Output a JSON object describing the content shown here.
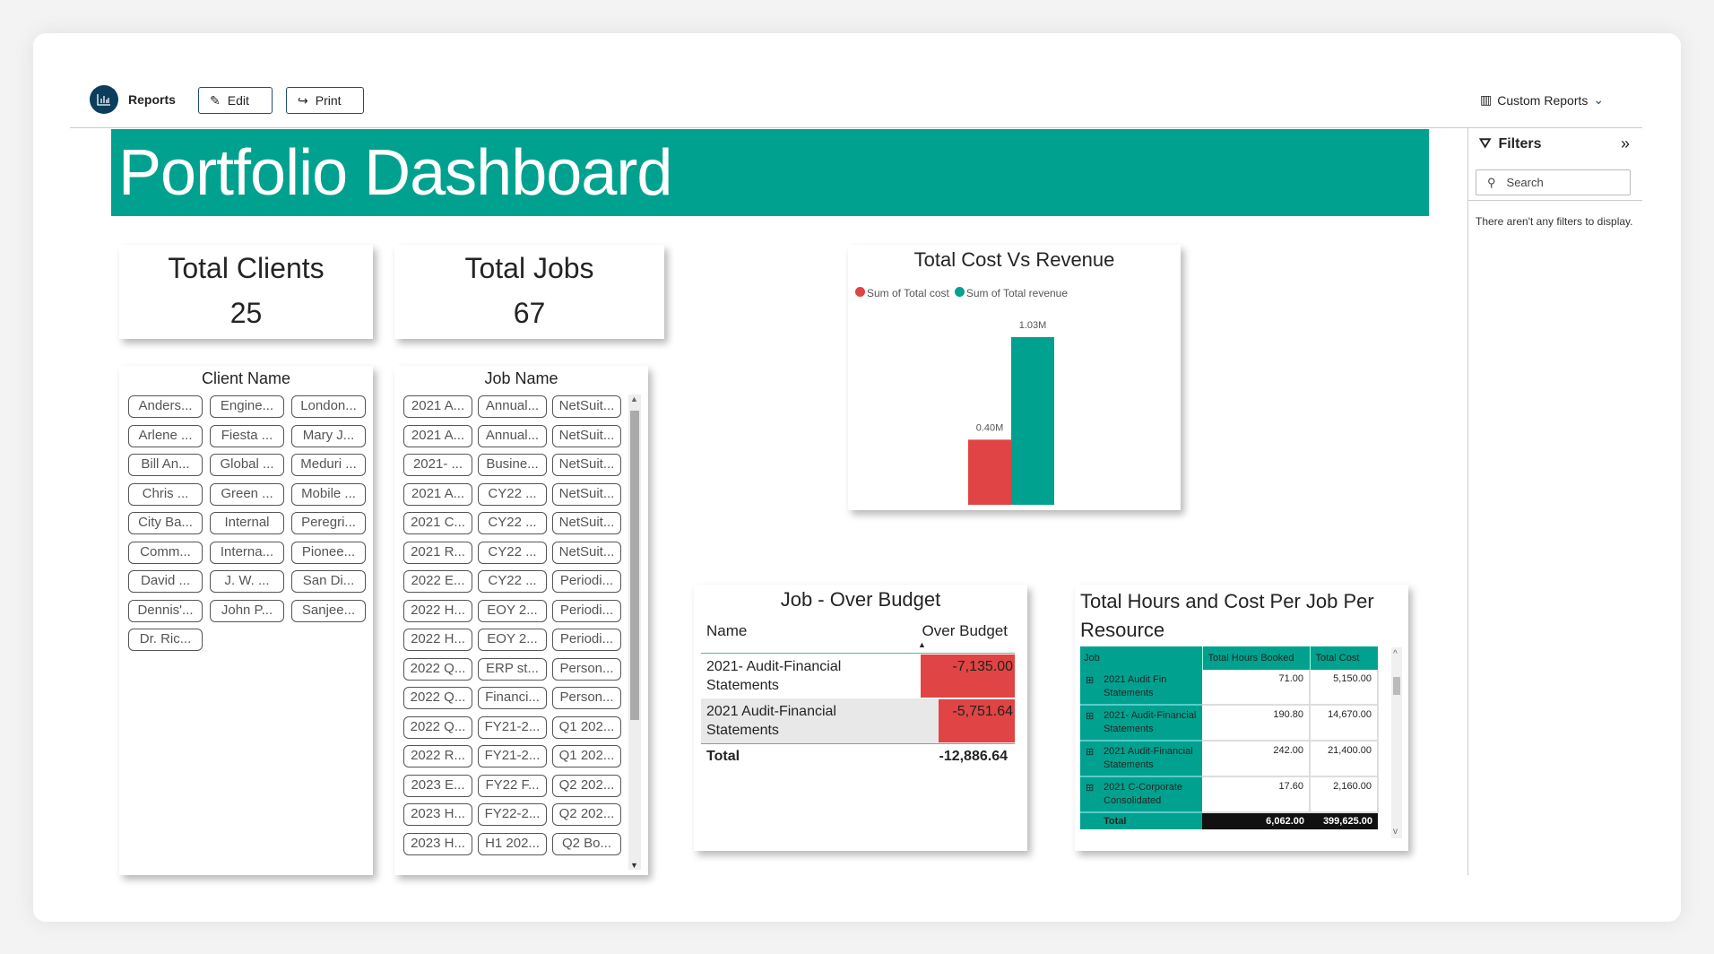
{
  "header": {
    "app_label": "Reports",
    "edit_label": "Edit",
    "print_label": "Print",
    "custom_reports_label": "Custom Reports"
  },
  "banner": {
    "title": "Portfolio Dashboard"
  },
  "colors": {
    "accent": "#00a28f",
    "cost": "#e04444",
    "revenue": "#00a28f",
    "logo": "#0b3d5c"
  },
  "filters": {
    "title": "Filters",
    "search_placeholder": "Search",
    "empty_text": "There aren't any filters to display."
  },
  "kpis": [
    {
      "title": "Total Clients",
      "value": "25"
    },
    {
      "title": "Total Jobs",
      "value": "67"
    }
  ],
  "client_slicer": {
    "title": "Client Name",
    "items": [
      "Anders...",
      "Engine...",
      "London...",
      "Arlene ...",
      "Fiesta ...",
      "Mary J...",
      "Bill An...",
      "Global ...",
      "Meduri ...",
      "Chris ...",
      "Green ...",
      "Mobile ...",
      "City Ba...",
      "Internal",
      "Peregri...",
      "Comm...",
      "Interna...",
      "Pionee...",
      "David ...",
      "J. W. ...",
      "San Di...",
      "Dennis'...",
      "John P...",
      "Sanjee...",
      "Dr. Ric..."
    ]
  },
  "job_slicer": {
    "title": "Job Name",
    "items": [
      "2021 A...",
      "Annual...",
      "NetSuit...",
      "2021 A...",
      "Annual...",
      "NetSuit...",
      "2021- ...",
      "Busine...",
      "NetSuit...",
      "2021 A...",
      "CY22 ...",
      "NetSuit...",
      "2021 C...",
      "CY22 ...",
      "NetSuit...",
      "2021 R...",
      "CY22 ...",
      "NetSuit...",
      "2022 E...",
      "CY22 ...",
      "Periodi...",
      "2022 H...",
      "EOY 2...",
      "Periodi...",
      "2022 H...",
      "EOY 2...",
      "Periodi...",
      "2022 Q...",
      "ERP st...",
      "Person...",
      "2022 Q...",
      "Financi...",
      "Person...",
      "2022 Q...",
      "FY21-2...",
      "Q1 202...",
      "2022 R...",
      "FY21-2...",
      "Q1 202...",
      "2023 E...",
      "FY22 F...",
      "Q2 202...",
      "2023 H...",
      "FY22-2...",
      "Q2 202...",
      "2023 H...",
      "H1 202...",
      "Q2 Bo..."
    ]
  },
  "chart_data": {
    "type": "bar",
    "title": "Total Cost Vs Revenue",
    "series": [
      {
        "name": "Sum of Total cost",
        "values": [
          0.4
        ],
        "label": "0.40M",
        "color": "#e04444"
      },
      {
        "name": "Sum of Total revenue",
        "values": [
          1.03
        ],
        "label": "1.03M",
        "color": "#00a28f"
      }
    ],
    "unit": "M",
    "legend": "top-left",
    "grid": false
  },
  "over_budget": {
    "title": "Job - Over Budget",
    "columns": [
      "Name",
      "Over Budget"
    ],
    "rows": [
      {
        "name": "2021- Audit-Financial Statements",
        "value": "-7,135.00",
        "amount": -7135.0
      },
      {
        "name": "2021 Audit-Financial Statements",
        "value": "-5,751.64",
        "amount": -5751.64
      }
    ],
    "total_label": "Total",
    "total": "-12,886.64"
  },
  "hours": {
    "title": "Total Hours and Cost Per Job Per Resource",
    "columns": [
      "Job",
      "Total Hours Booked",
      "Total Cost"
    ],
    "rows": [
      {
        "job": "2021 Audit Fin Statements",
        "hours": "71.00",
        "cost": "5,150.00"
      },
      {
        "job": "2021- Audit-Financial Statements",
        "hours": "190.80",
        "cost": "14,670.00"
      },
      {
        "job": "2021 Audit-Financial Statements",
        "hours": "242.00",
        "cost": "21,400.00"
      },
      {
        "job": "2021 C-Corporate Consolidated",
        "hours": "17.60",
        "cost": "2,160.00"
      }
    ],
    "total_label": "Total",
    "total_hours": "6,062.00",
    "total_cost": "399,625.00"
  }
}
